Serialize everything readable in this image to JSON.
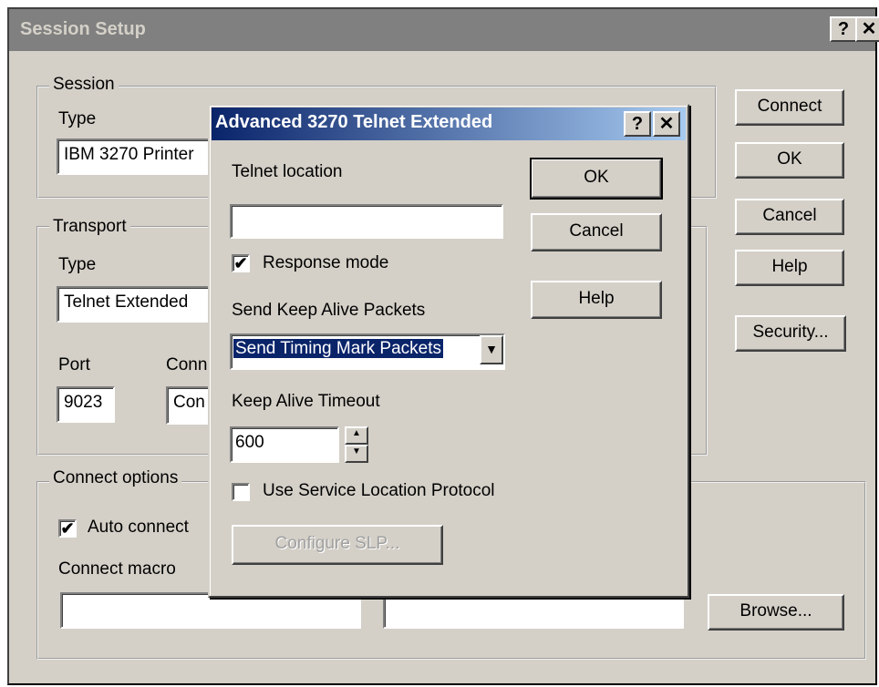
{
  "main_window": {
    "title": "Session Setup",
    "help_btn": "?",
    "close_btn": "✕",
    "session": {
      "group_label": "Session",
      "type_label": "Type",
      "type_value": "IBM 3270 Printer"
    },
    "transport": {
      "group_label": "Transport",
      "type_label": "Type",
      "type_value": "Telnet Extended",
      "port_label": "Port",
      "port_value": "9023",
      "conn_label": "Conn",
      "conn_value": "Con"
    },
    "connect_options": {
      "group_label": "Connect options",
      "auto_connect_label": "Auto connect",
      "auto_connect_checked": true,
      "auto_connect_mark": "✔",
      "connect_macro_label": "Connect macro",
      "connect_macro_value": "",
      "second_field_value": ""
    },
    "buttons": {
      "connect": "Connect",
      "ok": "OK",
      "cancel": "Cancel",
      "help": "Help",
      "security": "Security...",
      "browse": "Browse..."
    }
  },
  "dialog": {
    "title": "Advanced 3270 Telnet Extended",
    "help_btn": "?",
    "close_btn": "✕",
    "telnet_location_label": "Telnet location",
    "telnet_location_value": "",
    "response_mode_label": "Response mode",
    "response_mode_checked": true,
    "response_mode_mark": "✔",
    "keep_alive_label": "Send Keep Alive Packets",
    "keep_alive_value": "Send Timing Mark Packets",
    "keep_alive_arrow": "▼",
    "timeout_label": "Keep Alive Timeout",
    "timeout_value": "600",
    "spin_up": "▲",
    "spin_down": "▼",
    "slp_label": "Use Service Location Protocol",
    "slp_checked": false,
    "configure_slp": "Configure SLP...",
    "buttons": {
      "ok": "OK",
      "cancel": "Cancel",
      "help": "Help"
    }
  }
}
